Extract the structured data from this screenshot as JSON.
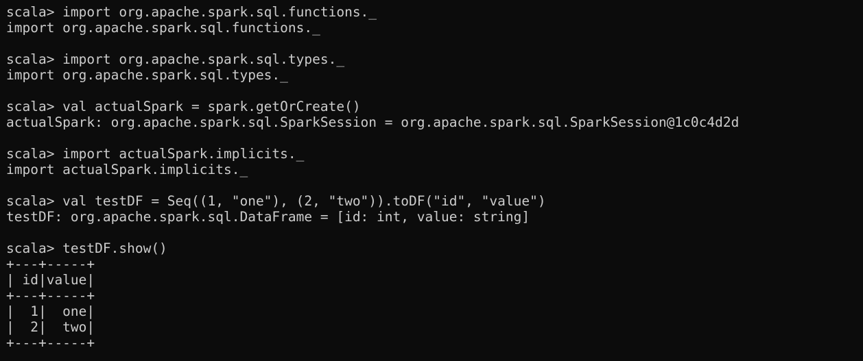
{
  "terminal": {
    "lines": [
      "scala> import org.apache.spark.sql.functions._",
      "import org.apache.spark.sql.functions._",
      "",
      "scala> import org.apache.spark.sql.types._",
      "import org.apache.spark.sql.types._",
      "",
      "scala> val actualSpark = spark.getOrCreate()",
      "actualSpark: org.apache.spark.sql.SparkSession = org.apache.spark.sql.SparkSession@1c0c4d2d",
      "",
      "scala> import actualSpark.implicits._",
      "import actualSpark.implicits._",
      "",
      "scala> val testDF = Seq((1, \"one\"), (2, \"two\")).toDF(\"id\", \"value\")",
      "testDF: org.apache.spark.sql.DataFrame = [id: int, value: string]",
      "",
      "scala> testDF.show()",
      "+---+-----+",
      "| id|value|",
      "+---+-----+",
      "|  1|  one|",
      "|  2|  two|",
      "+---+-----+"
    ]
  }
}
